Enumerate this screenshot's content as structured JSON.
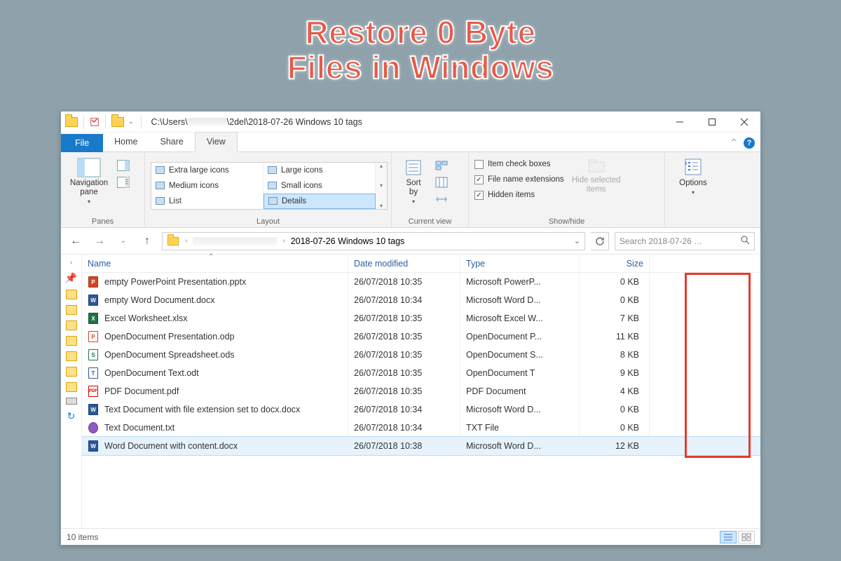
{
  "hero": {
    "line1": "Restore 0 Byte",
    "line2": "Files in Windows"
  },
  "titlebar": {
    "path_prefix": "C:\\Users\\",
    "path_suffix": "\\2del\\2018-07-26 Windows 10 tags"
  },
  "tabs": {
    "file": "File",
    "home": "Home",
    "share": "Share",
    "view": "View"
  },
  "ribbon": {
    "panes": {
      "navpane": "Navigation\npane",
      "label": "Panes"
    },
    "layout": {
      "xl": "Extra large icons",
      "lg": "Large icons",
      "md": "Medium icons",
      "sm": "Small icons",
      "list": "List",
      "details": "Details",
      "label": "Layout"
    },
    "current": {
      "sortby": "Sort\nby",
      "label": "Current view"
    },
    "show": {
      "checkboxes": "Item check boxes",
      "ext": "File name extensions",
      "hidden": "Hidden items",
      "hidesel": "Hide selected\nitems",
      "label": "Show/hide"
    },
    "options": {
      "btn": "Options"
    }
  },
  "address": {
    "crumb": "2018-07-26 Windows 10 tags",
    "search_placeholder": "Search 2018-07-26 …"
  },
  "columns": {
    "name": "Name",
    "date": "Date modified",
    "type": "Type",
    "size": "Size"
  },
  "files": [
    {
      "icon": "ppt",
      "name": "empty PowerPoint Presentation.pptx",
      "date": "26/07/2018 10:35",
      "type": "Microsoft PowerP...",
      "size": "0 KB"
    },
    {
      "icon": "word",
      "name": "empty Word Document.docx",
      "date": "26/07/2018 10:34",
      "type": "Microsoft Word D...",
      "size": "0 KB"
    },
    {
      "icon": "xls",
      "name": "Excel Worksheet.xlsx",
      "date": "26/07/2018 10:35",
      "type": "Microsoft Excel W...",
      "size": "7 KB"
    },
    {
      "icon": "odp",
      "name": "OpenDocument Presentation.odp",
      "date": "26/07/2018 10:35",
      "type": "OpenDocument P...",
      "size": "11 KB"
    },
    {
      "icon": "ods",
      "name": "OpenDocument Spreadsheet.ods",
      "date": "26/07/2018 10:35",
      "type": "OpenDocument S...",
      "size": "8 KB"
    },
    {
      "icon": "odt",
      "name": "OpenDocument Text.odt",
      "date": "26/07/2018 10:35",
      "type": "OpenDocument T",
      "size": "9 KB"
    },
    {
      "icon": "pdf",
      "name": "PDF Document.pdf",
      "date": "26/07/2018 10:35",
      "type": "PDF Document",
      "size": "4 KB"
    },
    {
      "icon": "word",
      "name": "Text Document with file extension set to docx.docx",
      "date": "26/07/2018 10:34",
      "type": "Microsoft Word D...",
      "size": "0 KB"
    },
    {
      "icon": "txt",
      "name": "Text Document.txt",
      "date": "26/07/2018 10:34",
      "type": "TXT File",
      "size": "0 KB"
    },
    {
      "icon": "word",
      "name": "Word Document with content.docx",
      "date": "26/07/2018 10:38",
      "type": "Microsoft Word D...",
      "size": "12 KB",
      "selected": true
    }
  ],
  "status": {
    "count": "10 items"
  }
}
